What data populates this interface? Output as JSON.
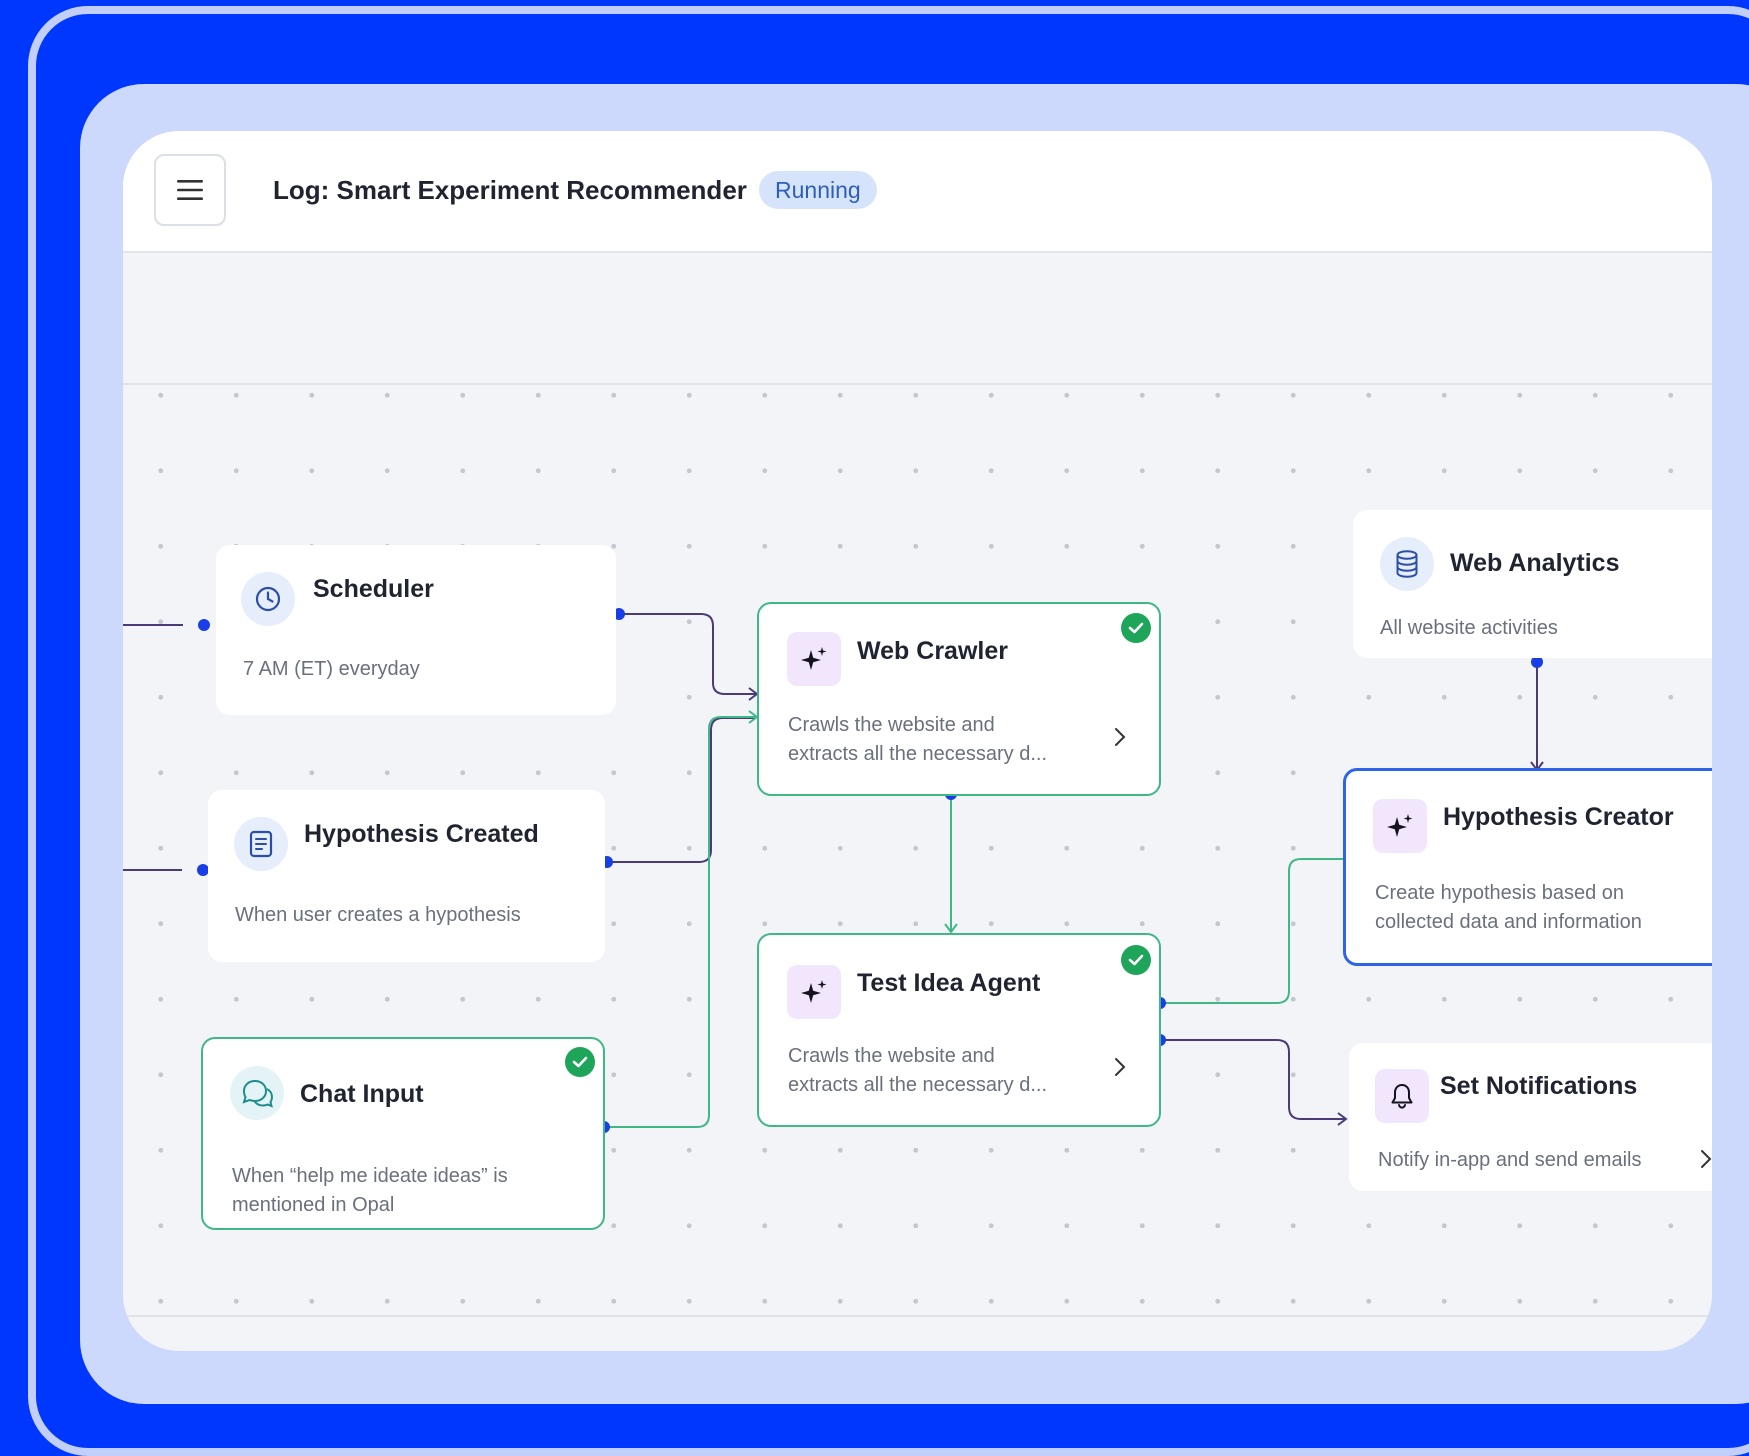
{
  "header": {
    "title": "Log: Smart Experiment Recommender",
    "status": "Running",
    "menu_icon": "hamburger-menu-icon"
  },
  "nodes": {
    "scheduler": {
      "title": "Scheduler",
      "desc": "7 AM (ET) everyday",
      "icon": "clock-icon"
    },
    "hypothesis_created": {
      "title": "Hypothesis Created",
      "desc": "When user creates a hypothesis",
      "icon": "document-icon"
    },
    "chat_input": {
      "title": "Chat Input",
      "desc_line1": "When “help me ideate ideas” is",
      "desc_line2": "mentioned in Opal",
      "icon": "chat-bubbles-icon"
    },
    "web_crawler": {
      "title": "Web Crawler",
      "desc_line1": "Crawls the website and",
      "desc_line2": "extracts all the necessary d...",
      "icon": "sparkle-icon"
    },
    "test_idea_agent": {
      "title": "Test Idea Agent",
      "desc_line1": "Crawls the website and",
      "desc_line2": "extracts all the necessary d...",
      "icon": "sparkle-icon"
    },
    "web_analytics": {
      "title": "Web Analytics",
      "desc": "All website activities",
      "icon": "database-icon"
    },
    "hypothesis_creator": {
      "title": "Hypothesis Creator",
      "desc_line1": "Create hypothesis based on",
      "desc_line2": "collected data and information",
      "icon": "sparkle-icon"
    },
    "set_notifications": {
      "title": "Set Notifications",
      "desc": "Notify in-app and send emails",
      "icon": "bell-icon"
    }
  },
  "colors": {
    "background": "#0037ff",
    "success": "#1fa55a",
    "accent": "#2e64e8",
    "connector_green": "#3fb886",
    "connector_purple": "#4b3a78"
  }
}
